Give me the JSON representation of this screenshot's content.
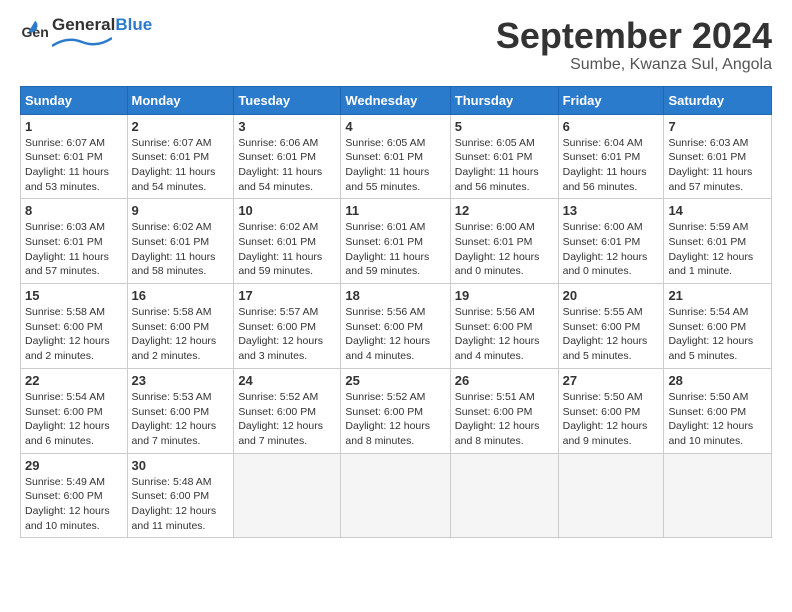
{
  "header": {
    "logo_general": "General",
    "logo_blue": "Blue",
    "title": "September 2024",
    "subtitle": "Sumbe, Kwanza Sul, Angola"
  },
  "weekdays": [
    "Sunday",
    "Monday",
    "Tuesday",
    "Wednesday",
    "Thursday",
    "Friday",
    "Saturday"
  ],
  "weeks": [
    [
      {
        "day": "1",
        "info": "Sunrise: 6:07 AM\nSunset: 6:01 PM\nDaylight: 11 hours and 53 minutes."
      },
      {
        "day": "2",
        "info": "Sunrise: 6:07 AM\nSunset: 6:01 PM\nDaylight: 11 hours and 54 minutes."
      },
      {
        "day": "3",
        "info": "Sunrise: 6:06 AM\nSunset: 6:01 PM\nDaylight: 11 hours and 54 minutes."
      },
      {
        "day": "4",
        "info": "Sunrise: 6:05 AM\nSunset: 6:01 PM\nDaylight: 11 hours and 55 minutes."
      },
      {
        "day": "5",
        "info": "Sunrise: 6:05 AM\nSunset: 6:01 PM\nDaylight: 11 hours and 56 minutes."
      },
      {
        "day": "6",
        "info": "Sunrise: 6:04 AM\nSunset: 6:01 PM\nDaylight: 11 hours and 56 minutes."
      },
      {
        "day": "7",
        "info": "Sunrise: 6:03 AM\nSunset: 6:01 PM\nDaylight: 11 hours and 57 minutes."
      }
    ],
    [
      {
        "day": "8",
        "info": "Sunrise: 6:03 AM\nSunset: 6:01 PM\nDaylight: 11 hours and 57 minutes."
      },
      {
        "day": "9",
        "info": "Sunrise: 6:02 AM\nSunset: 6:01 PM\nDaylight: 11 hours and 58 minutes."
      },
      {
        "day": "10",
        "info": "Sunrise: 6:02 AM\nSunset: 6:01 PM\nDaylight: 11 hours and 59 minutes."
      },
      {
        "day": "11",
        "info": "Sunrise: 6:01 AM\nSunset: 6:01 PM\nDaylight: 11 hours and 59 minutes."
      },
      {
        "day": "12",
        "info": "Sunrise: 6:00 AM\nSunset: 6:01 PM\nDaylight: 12 hours and 0 minutes."
      },
      {
        "day": "13",
        "info": "Sunrise: 6:00 AM\nSunset: 6:01 PM\nDaylight: 12 hours and 0 minutes."
      },
      {
        "day": "14",
        "info": "Sunrise: 5:59 AM\nSunset: 6:01 PM\nDaylight: 12 hours and 1 minute."
      }
    ],
    [
      {
        "day": "15",
        "info": "Sunrise: 5:58 AM\nSunset: 6:00 PM\nDaylight: 12 hours and 2 minutes."
      },
      {
        "day": "16",
        "info": "Sunrise: 5:58 AM\nSunset: 6:00 PM\nDaylight: 12 hours and 2 minutes."
      },
      {
        "day": "17",
        "info": "Sunrise: 5:57 AM\nSunset: 6:00 PM\nDaylight: 12 hours and 3 minutes."
      },
      {
        "day": "18",
        "info": "Sunrise: 5:56 AM\nSunset: 6:00 PM\nDaylight: 12 hours and 4 minutes."
      },
      {
        "day": "19",
        "info": "Sunrise: 5:56 AM\nSunset: 6:00 PM\nDaylight: 12 hours and 4 minutes."
      },
      {
        "day": "20",
        "info": "Sunrise: 5:55 AM\nSunset: 6:00 PM\nDaylight: 12 hours and 5 minutes."
      },
      {
        "day": "21",
        "info": "Sunrise: 5:54 AM\nSunset: 6:00 PM\nDaylight: 12 hours and 5 minutes."
      }
    ],
    [
      {
        "day": "22",
        "info": "Sunrise: 5:54 AM\nSunset: 6:00 PM\nDaylight: 12 hours and 6 minutes."
      },
      {
        "day": "23",
        "info": "Sunrise: 5:53 AM\nSunset: 6:00 PM\nDaylight: 12 hours and 7 minutes."
      },
      {
        "day": "24",
        "info": "Sunrise: 5:52 AM\nSunset: 6:00 PM\nDaylight: 12 hours and 7 minutes."
      },
      {
        "day": "25",
        "info": "Sunrise: 5:52 AM\nSunset: 6:00 PM\nDaylight: 12 hours and 8 minutes."
      },
      {
        "day": "26",
        "info": "Sunrise: 5:51 AM\nSunset: 6:00 PM\nDaylight: 12 hours and 8 minutes."
      },
      {
        "day": "27",
        "info": "Sunrise: 5:50 AM\nSunset: 6:00 PM\nDaylight: 12 hours and 9 minutes."
      },
      {
        "day": "28",
        "info": "Sunrise: 5:50 AM\nSunset: 6:00 PM\nDaylight: 12 hours and 10 minutes."
      }
    ],
    [
      {
        "day": "29",
        "info": "Sunrise: 5:49 AM\nSunset: 6:00 PM\nDaylight: 12 hours and 10 minutes."
      },
      {
        "day": "30",
        "info": "Sunrise: 5:48 AM\nSunset: 6:00 PM\nDaylight: 12 hours and 11 minutes."
      },
      {
        "day": "",
        "info": ""
      },
      {
        "day": "",
        "info": ""
      },
      {
        "day": "",
        "info": ""
      },
      {
        "day": "",
        "info": ""
      },
      {
        "day": "",
        "info": ""
      }
    ]
  ]
}
